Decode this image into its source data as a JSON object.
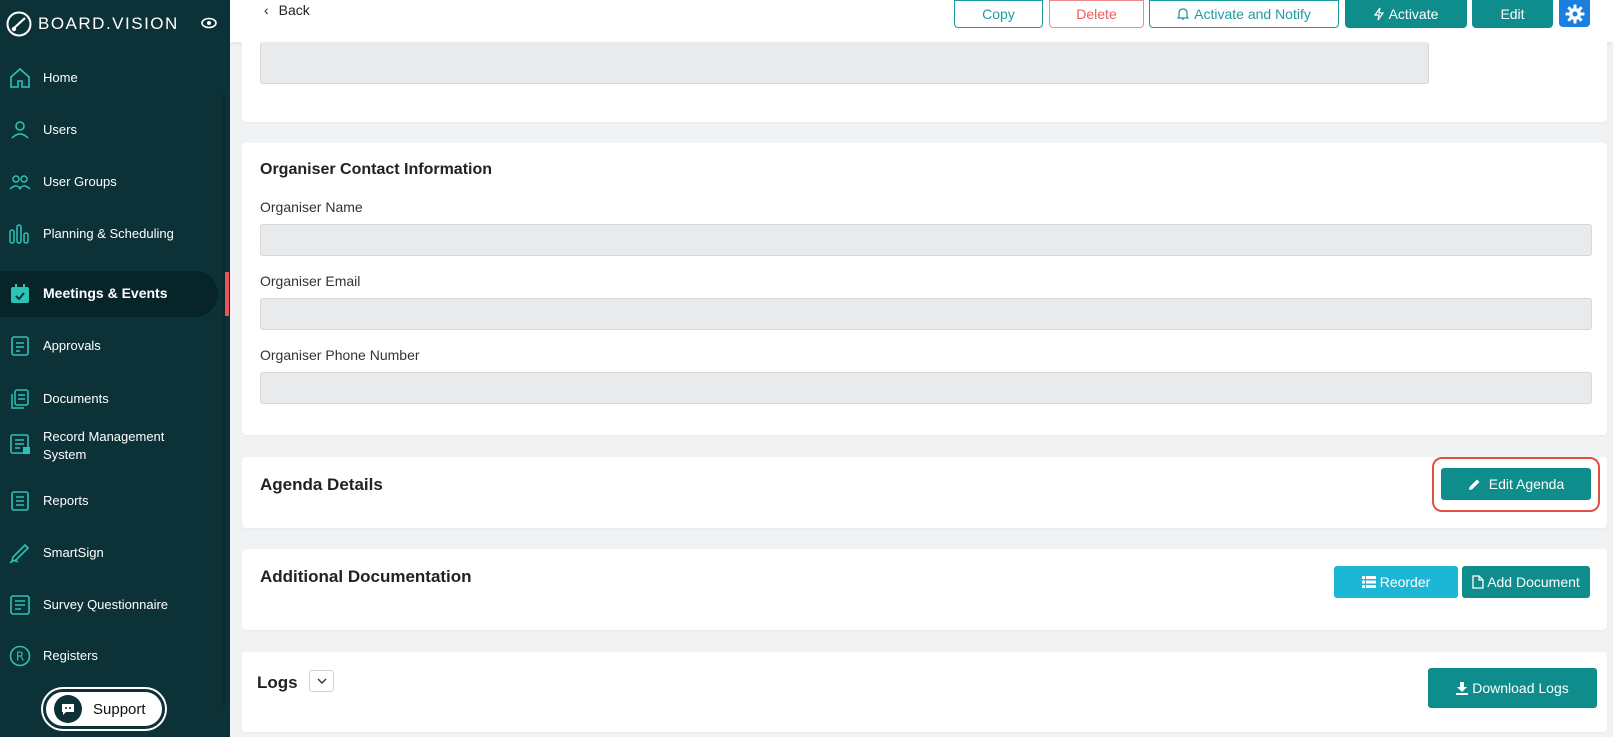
{
  "brand": {
    "name": "BOARD.VISION"
  },
  "sidebar": {
    "items": [
      {
        "label": "Home",
        "icon": "home-icon"
      },
      {
        "label": "Users",
        "icon": "user-icon"
      },
      {
        "label": "User Groups",
        "icon": "user-group-icon"
      },
      {
        "label": "Planning & Scheduling",
        "icon": "bar-chart-icon"
      },
      {
        "label": "Meetings & Events",
        "icon": "calendar-check-icon",
        "active": true
      },
      {
        "label": "Approvals",
        "icon": "approval-doc-icon"
      },
      {
        "label": "Documents",
        "icon": "documents-icon"
      },
      {
        "label": "Record Management System",
        "icon": "record-icon"
      },
      {
        "label": "Reports",
        "icon": "report-list-icon"
      },
      {
        "label": "SmartSign",
        "icon": "pen-icon"
      },
      {
        "label": "Survey Questionnaire",
        "icon": "survey-icon"
      },
      {
        "label": "Registers",
        "icon": "registered-icon"
      }
    ],
    "support_label": "Support"
  },
  "topbar": {
    "back_label": "Back",
    "copy_label": "Copy",
    "delete_label": "Delete",
    "activate_notify_label": "Activate and Notify",
    "activate_label": "Activate",
    "edit_label": "Edit"
  },
  "organiser": {
    "title": "Organiser Contact Information",
    "name_label": "Organiser Name",
    "name_value": "",
    "email_label": "Organiser Email",
    "email_value": "",
    "phone_label": "Organiser Phone Number",
    "phone_value": ""
  },
  "agenda": {
    "title": "Agenda Details",
    "edit_label": "Edit Agenda"
  },
  "additional_docs": {
    "title": "Additional Documentation",
    "reorder_label": "Reorder",
    "add_document_label": "Add Document"
  },
  "logs": {
    "title": "Logs",
    "download_label": "Download Logs"
  },
  "colors": {
    "sidebar_bg": "#0c3238",
    "accent_teal": "#0f8c8c",
    "accent_cyan": "#1db6d6",
    "danger": "#ef5a5a",
    "settings_blue": "#1c7fe0",
    "highlight": "#e2503e"
  }
}
